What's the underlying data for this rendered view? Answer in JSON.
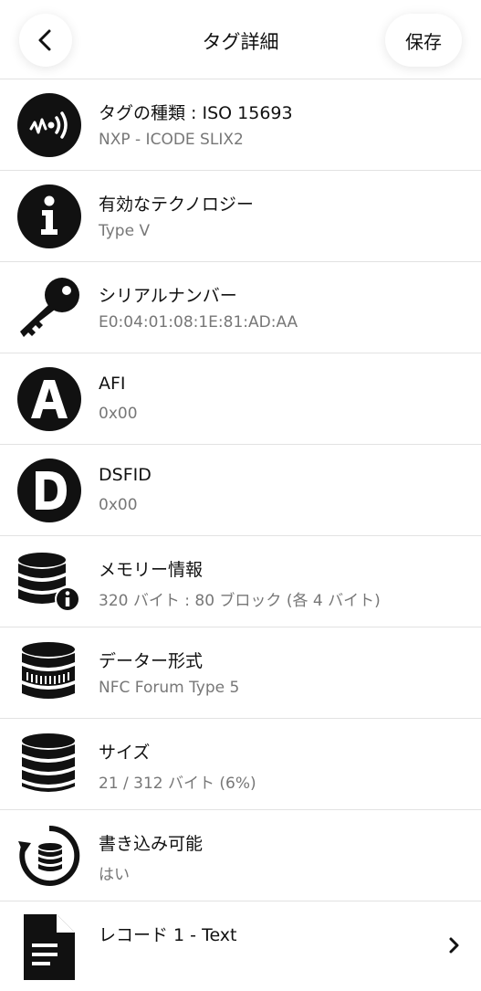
{
  "header": {
    "title": "タグ詳細",
    "save_label": "保存"
  },
  "rows": [
    {
      "icon": "nfc-signal-icon",
      "title": "タグの種類 : ISO 15693",
      "subtitle": "NXP - ICODE SLIX2"
    },
    {
      "icon": "info-icon",
      "title": "有効なテクノロジー",
      "subtitle": "Type V"
    },
    {
      "icon": "key-icon",
      "title": "シリアルナンバー",
      "subtitle": "E0:04:01:08:1E:81:AD:AA"
    },
    {
      "icon": "letter-a-icon",
      "title": "AFI",
      "subtitle": "0x00"
    },
    {
      "icon": "letter-d-icon",
      "title": "DSFID",
      "subtitle": "0x00"
    },
    {
      "icon": "database-info-icon",
      "title": "メモリー情報",
      "subtitle": "320 バイト : 80 ブロック (各 4 バイト)"
    },
    {
      "icon": "database-format-icon",
      "title": "データー形式",
      "subtitle": "NFC Forum Type 5"
    },
    {
      "icon": "database-icon",
      "title": "サイズ",
      "subtitle": "21 / 312 バイト (6%)"
    },
    {
      "icon": "database-refresh-icon",
      "title": "書き込み可能",
      "subtitle": "はい"
    },
    {
      "icon": "document-icon",
      "title": "レコード 1 - Text"
    }
  ]
}
